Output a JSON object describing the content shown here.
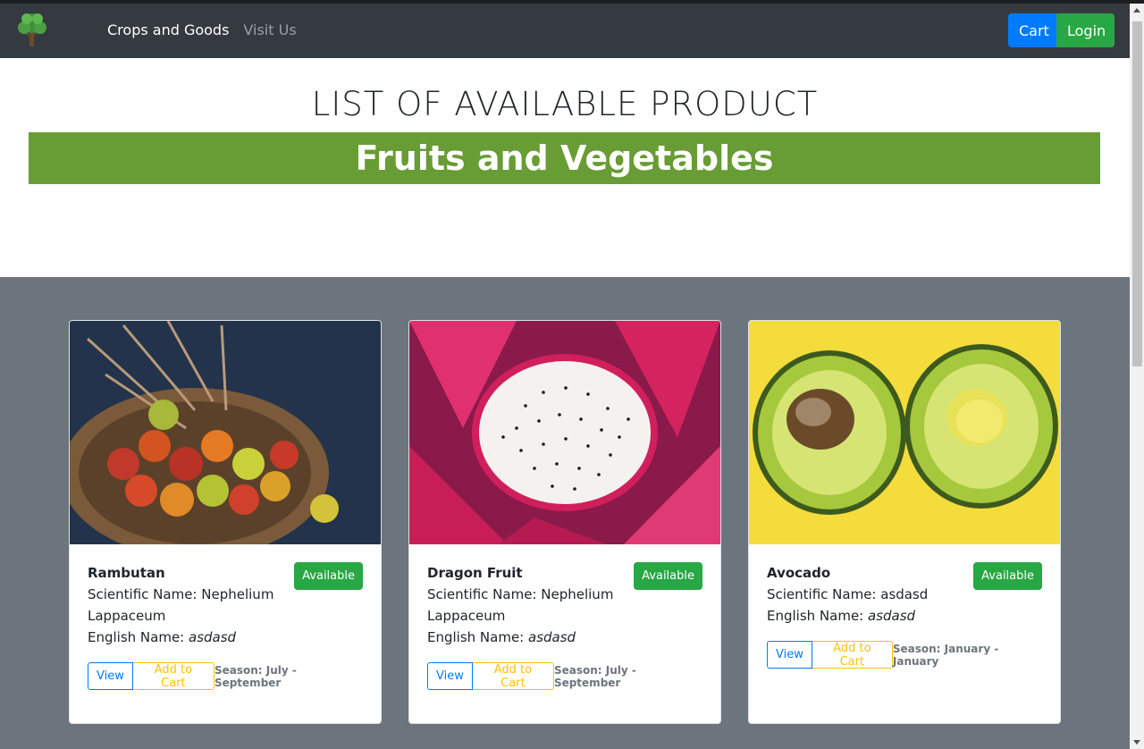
{
  "nav": {
    "logo": "tree-logo",
    "links": [
      "Crops and Goods",
      "Visit Us"
    ],
    "cart_label": "Cart",
    "login_label": "Login"
  },
  "header": {
    "title": "LIST OF AVAILABLE PRODUCT",
    "banner": "Fruits and Vegetables"
  },
  "products": [
    {
      "name": "Rambutan",
      "scientific_label": "Scientific Name: ",
      "scientific": "Nephelium Lappaceum",
      "english_label": "English Name: ",
      "english": "asdasd",
      "badge": "Available",
      "view_label": "View",
      "add_label": "Add to Cart",
      "season": "Season: July - September",
      "image": "rambutan-photo"
    },
    {
      "name": "Dragon Fruit",
      "scientific_label": "Scientific Name: ",
      "scientific": "Nephelium Lappaceum",
      "english_label": "English Name: ",
      "english": "asdasd",
      "badge": "Available",
      "view_label": "View",
      "add_label": "Add to Cart",
      "season": "Season: July - September",
      "image": "dragon-fruit-photo"
    },
    {
      "name": "Avocado",
      "scientific_label": "Scientific Name: ",
      "scientific": "asdasd",
      "english_label": "English Name: ",
      "english": "asdasd",
      "badge": "Available",
      "view_label": "View",
      "add_label": "Add to Cart",
      "season": "Season: January - January",
      "image": "avocado-photo"
    }
  ],
  "colors": {
    "navbar": "#343a40",
    "banner": "#689c34",
    "products_bg": "#6c757d",
    "primary": "#007bff",
    "success": "#28a745",
    "warning": "#ffc107"
  }
}
